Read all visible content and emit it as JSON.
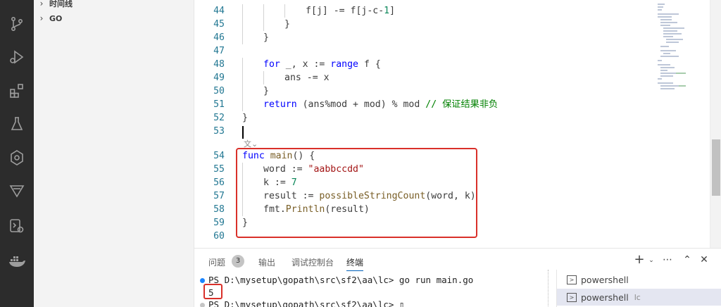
{
  "sidebar": {
    "timeline_label": "时间线",
    "go_label": "GO"
  },
  "activity_icons": [
    "source-control-icon",
    "run-debug-icon",
    "extensions-icon",
    "testing-icon",
    "gitlens-icon",
    "filter-icon",
    "remote-icon",
    "docker-icon"
  ],
  "editor": {
    "lines": [
      {
        "n": "44",
        "indent": 3,
        "html": "f[j] -= f[j-c-<span class='num'>1</span>]"
      },
      {
        "n": "45",
        "indent": 2,
        "html": "}"
      },
      {
        "n": "46",
        "indent": 1,
        "html": "}"
      },
      {
        "n": "47",
        "indent": 0,
        "html": ""
      },
      {
        "n": "48",
        "indent": 1,
        "html": "<span class='kw'>for</span> _, x := <span class='kw'>range</span> f {"
      },
      {
        "n": "49",
        "indent": 2,
        "html": "ans -= x"
      },
      {
        "n": "50",
        "indent": 1,
        "html": "}"
      },
      {
        "n": "51",
        "indent": 1,
        "html": "<span class='kw'>return</span> (ans%mod + mod) % mod <span class='cm'>// 保证结果非负</span>"
      },
      {
        "n": "52",
        "indent": 0,
        "html": "}"
      },
      {
        "n": "53",
        "indent": 0,
        "html": ""
      },
      {
        "n": "54",
        "indent": 0,
        "html": "<span class='kw'>func</span> <span class='fn'>main</span>() {"
      },
      {
        "n": "55",
        "indent": 1,
        "html": "word := <span class='str'>\"aabbccdd\"</span>"
      },
      {
        "n": "56",
        "indent": 1,
        "html": "k := <span class='num'>7</span>"
      },
      {
        "n": "57",
        "indent": 1,
        "html": "result := <span class='fn'>possibleStringCount</span>(word, k)"
      },
      {
        "n": "58",
        "indent": 1,
        "html": "fmt.<span class='fn'>Println</span>(result)"
      },
      {
        "n": "59",
        "indent": 0,
        "html": "}"
      },
      {
        "n": "60",
        "indent": 0,
        "html": ""
      }
    ],
    "codelens_icon": "translate-icon"
  },
  "panel": {
    "tabs": [
      {
        "label": "问题",
        "active": false
      },
      {
        "label": "输出",
        "active": false
      },
      {
        "label": "调试控制台",
        "active": false
      },
      {
        "label": "终端",
        "active": true
      }
    ],
    "problems_count": "3",
    "terminal_lines": [
      {
        "text": "PS D:\\mysetup\\gopath\\src\\sf2\\aa\\lc> go run main.go",
        "dot_color": "#1a85ff"
      },
      {
        "text": "5",
        "dot_color": ""
      },
      {
        "text": "PS D:\\mysetup\\gopath\\src\\sf2\\aa\\lc> ▯",
        "dot_color": "#c5c5c5"
      }
    ],
    "terminals": [
      {
        "label": "powershell",
        "sub": "",
        "selected": false
      },
      {
        "label": "powershell",
        "sub": "lc",
        "selected": true
      }
    ],
    "controls": [
      "plus-icon",
      "chevron-down-icon",
      "more-icon",
      "chevron-up-icon",
      "close-icon"
    ]
  }
}
